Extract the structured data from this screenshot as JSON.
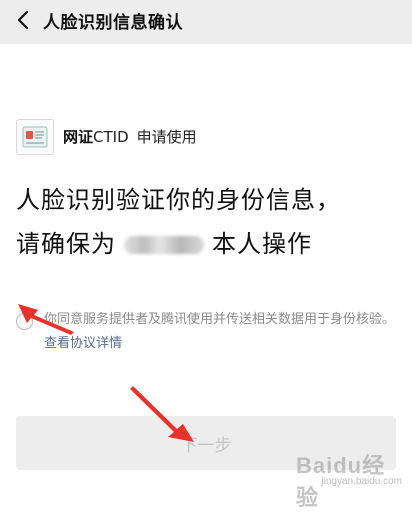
{
  "header": {
    "title": "人脸识别信息确认",
    "back_icon": "chevron-left-icon"
  },
  "app": {
    "name": "网证",
    "name_suffix": "CTID",
    "request_text": "申请使用",
    "logo_icon": "id-card-icon"
  },
  "headline": {
    "line1": "人脸识别验证你的身份信息，",
    "line2_prefix": "请确保为",
    "line2_suffix": "本人操作"
  },
  "consent": {
    "checked": false,
    "text": "你同意服务提供者及腾讯使用并传送相关数据用于身份核验。",
    "link": "查看协议详情"
  },
  "actions": {
    "next_label": "下一步",
    "next_enabled": false
  },
  "annotations": {
    "arrow_color": "#e8322b"
  },
  "watermark": {
    "main": "Baidu经验",
    "sub": "jingyan.baidu.com"
  },
  "colors": {
    "topbar": "#ededed",
    "link": "#576b95",
    "disabled_text": "#c4c4c4",
    "arrow": "#e8322b"
  }
}
